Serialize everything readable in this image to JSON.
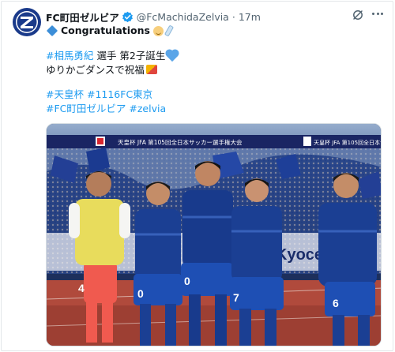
{
  "tweet": {
    "display_name": "FC町田ゼルビア",
    "handle": "@FcMachidaZelvia",
    "separator": "·",
    "time": "17m",
    "line1_text": "Congratulations",
    "line2_hashtag": "#相馬勇紀",
    "line2_text": " 選手 第2子誕生",
    "line3_text": "ゆりかごダンスで祝福",
    "line4_hashtags": [
      "#天皇杯",
      "#1116FC東京"
    ],
    "line5_hashtags": [
      "#FC町田ゼルビア",
      "#zelvia"
    ]
  },
  "photo": {
    "banner_text": "天皇杯 JFA 第105回全日本サッカー選手権大会",
    "banner_text_short": "天皇杯 JFA 第105回全日本サッカー選手権大会",
    "sponsor_text": "Kyocera",
    "keeper_number": "4",
    "player_numbers": [
      "0",
      "0",
      "7",
      "6"
    ]
  },
  "colors": {
    "accent_link": "#1d9bf0",
    "verified": "#1d9bf0",
    "kit_blue": "#1b3f93",
    "keeper_yellow": "#e8dc5c",
    "keeper_shorts": "#f05a4f",
    "banner_navy": "#1a2563"
  },
  "icons": {
    "avatar": "zelvia-club-crest",
    "verified": "verified-badge-icon",
    "grok": "grok-icon",
    "more": "more-options-icon"
  }
}
